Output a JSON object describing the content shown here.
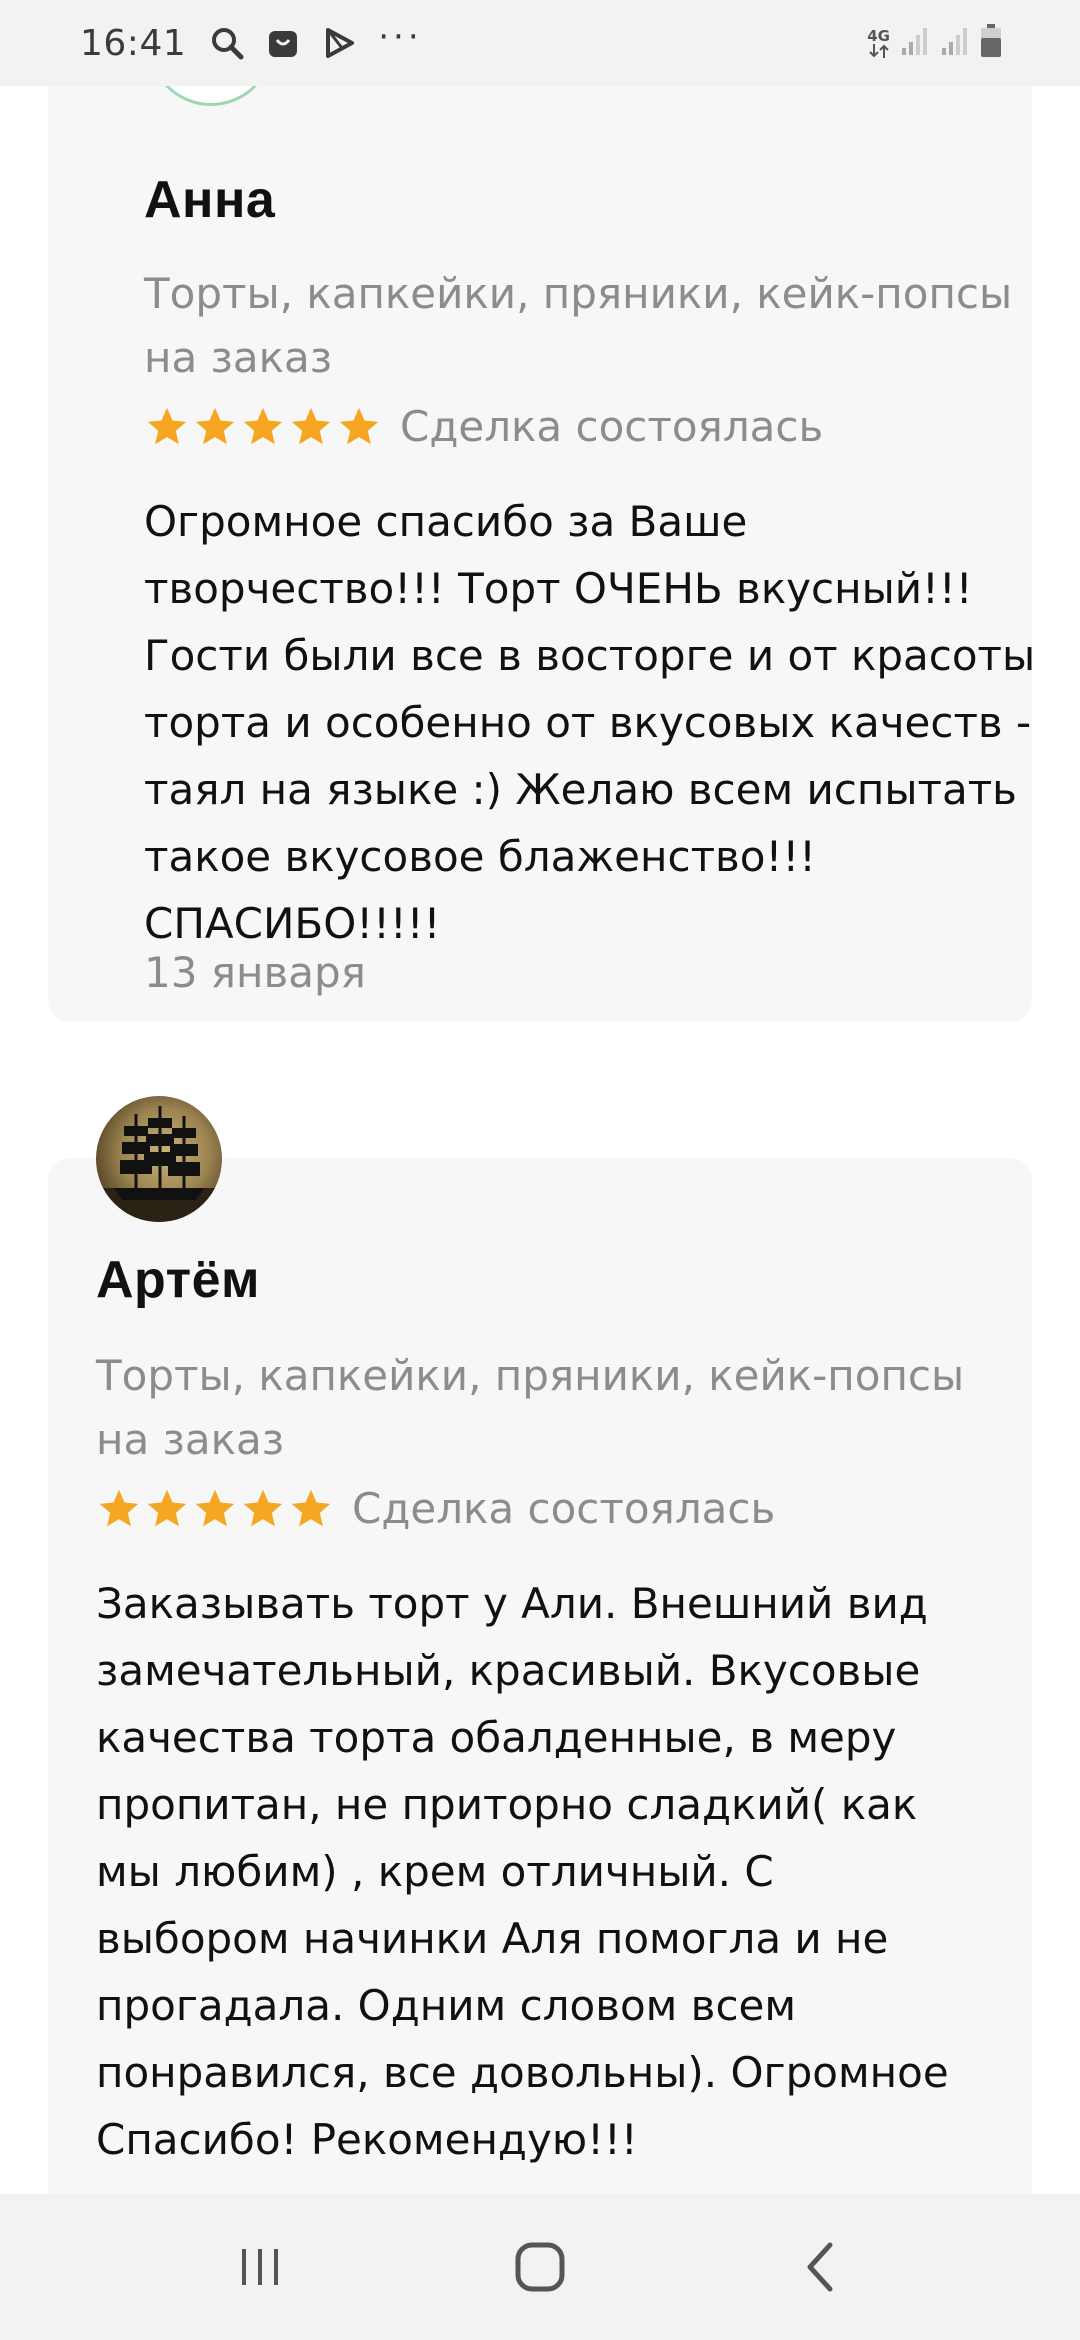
{
  "status_bar": {
    "time": "16:41",
    "icons": [
      "search-icon",
      "store-icon",
      "play-icon"
    ],
    "more": "···",
    "network": "4G"
  },
  "reviews": [
    {
      "author": "Анна",
      "service_line1": "Торты, капкейки, пряники, кейк-попсы",
      "service_line2": "на заказ",
      "stars": 5,
      "deal_status": "Сделка состоялась",
      "text_lines": [
        "Огромное спасибо за Ваше",
        "творчество!!! Торт ОЧЕНЬ вкусный!!!",
        "Гости были все в восторге и от красоты",
        "торта и особенно от вкусовых качеств -",
        "таял на языке :) Желаю всем испытать",
        "такое вкусовое блаженство!!!",
        "СПАСИБО!!!!!"
      ],
      "date": "13 января"
    },
    {
      "author": "Артём",
      "service_line1": "Торты, капкейки, пряники, кейк-попсы",
      "service_line2": "на заказ",
      "stars": 5,
      "deal_status": "Сделка состоялась",
      "text_lines": [
        "Заказывать торт у Али.  Внешний вид",
        "замечательный, красивый. Вкусовые",
        "качества торта обалденные,  в меру",
        "пропитан,  не приторно сладкий( как",
        "мы любим)  , крем отличный.  С",
        "выбором начинки Аля помогла и не",
        "прогадала.  Одним словом всем",
        "понравился,  все довольны).  Огромное",
        "Спасибо!  Рекомендую!!!"
      ]
    }
  ],
  "nav_bar": {
    "buttons": [
      "recent-apps-icon",
      "home-icon",
      "back-icon"
    ]
  },
  "colors": {
    "star": "#f5a623",
    "card_bg": "#f7f7f7",
    "muted_text": "#8c8c8c"
  }
}
